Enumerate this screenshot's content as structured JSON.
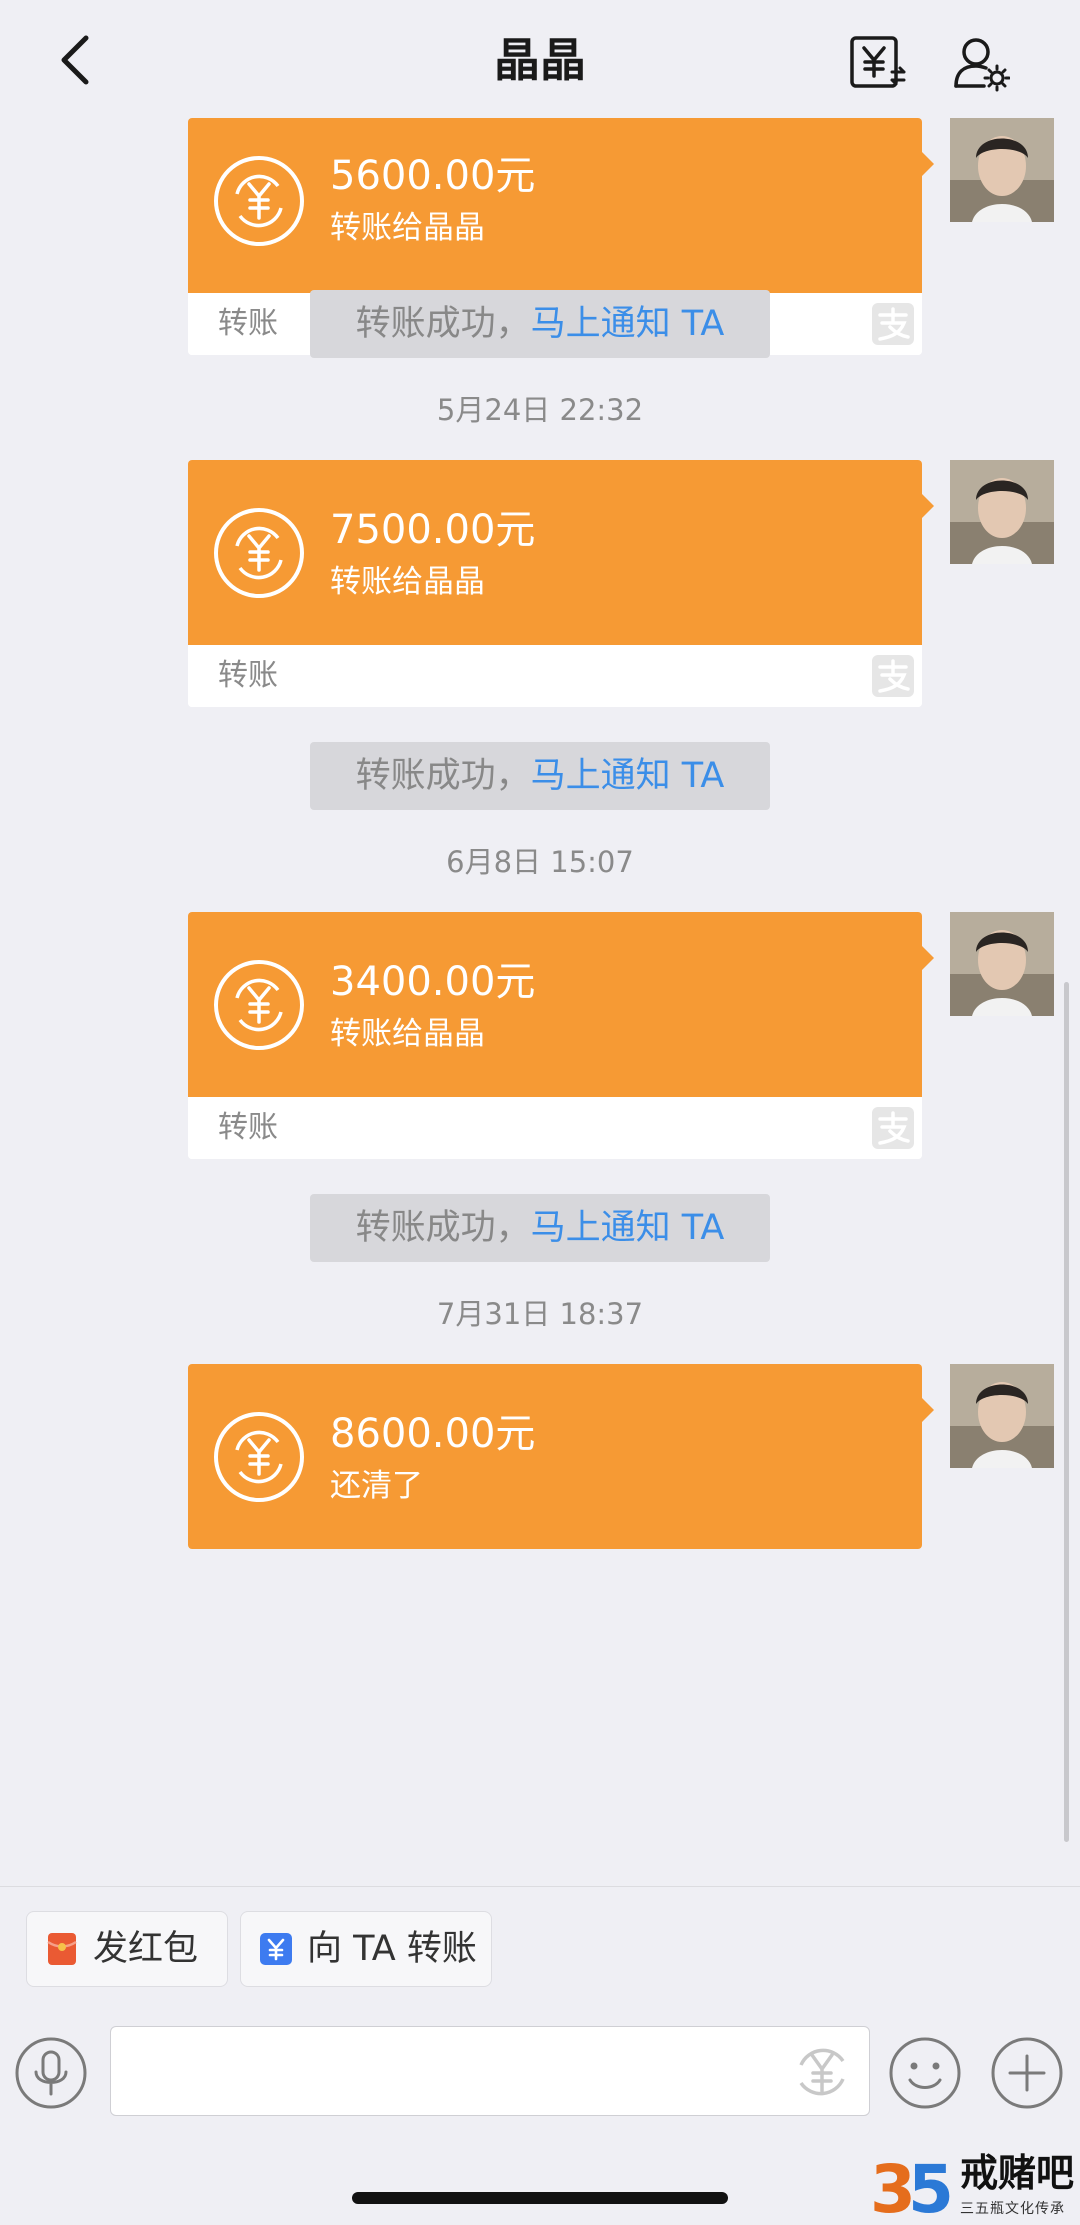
{
  "header": {
    "title": "晶晶",
    "back_icon": "chevron-left-icon",
    "transfer_icon": "yuan-transfer-icon",
    "profile_icon": "user-settings-icon"
  },
  "colors": {
    "card_orange": "#f69a34",
    "link_blue": "#3b8ee8",
    "background": "#efeff4"
  },
  "messages": [
    {
      "amount": "5600.00元",
      "memo": "转账给晶晶",
      "type": "转账",
      "notice_text": "转账成功，",
      "notice_link": "马上通知 TA"
    },
    {
      "time": "5月24日 22:32",
      "amount": "7500.00元",
      "memo": "转账给晶晶",
      "type": "转账",
      "notice_text": "转账成功，",
      "notice_link": "马上通知 TA"
    },
    {
      "time": "6月8日 15:07",
      "amount": "3400.00元",
      "memo": "转账给晶晶",
      "type": "转账",
      "notice_text": "转账成功，",
      "notice_link": "马上通知 TA"
    },
    {
      "time": "7月31日 18:37",
      "amount": "8600.00元",
      "memo": "还清了"
    }
  ],
  "quick_actions": {
    "red_packet": "发红包",
    "transfer": "向 TA 转账"
  },
  "input": {
    "placeholder": "",
    "value": ""
  },
  "watermark": {
    "logo": "35",
    "name": "戒赌吧",
    "tagline": "三五瓶文化传承"
  }
}
